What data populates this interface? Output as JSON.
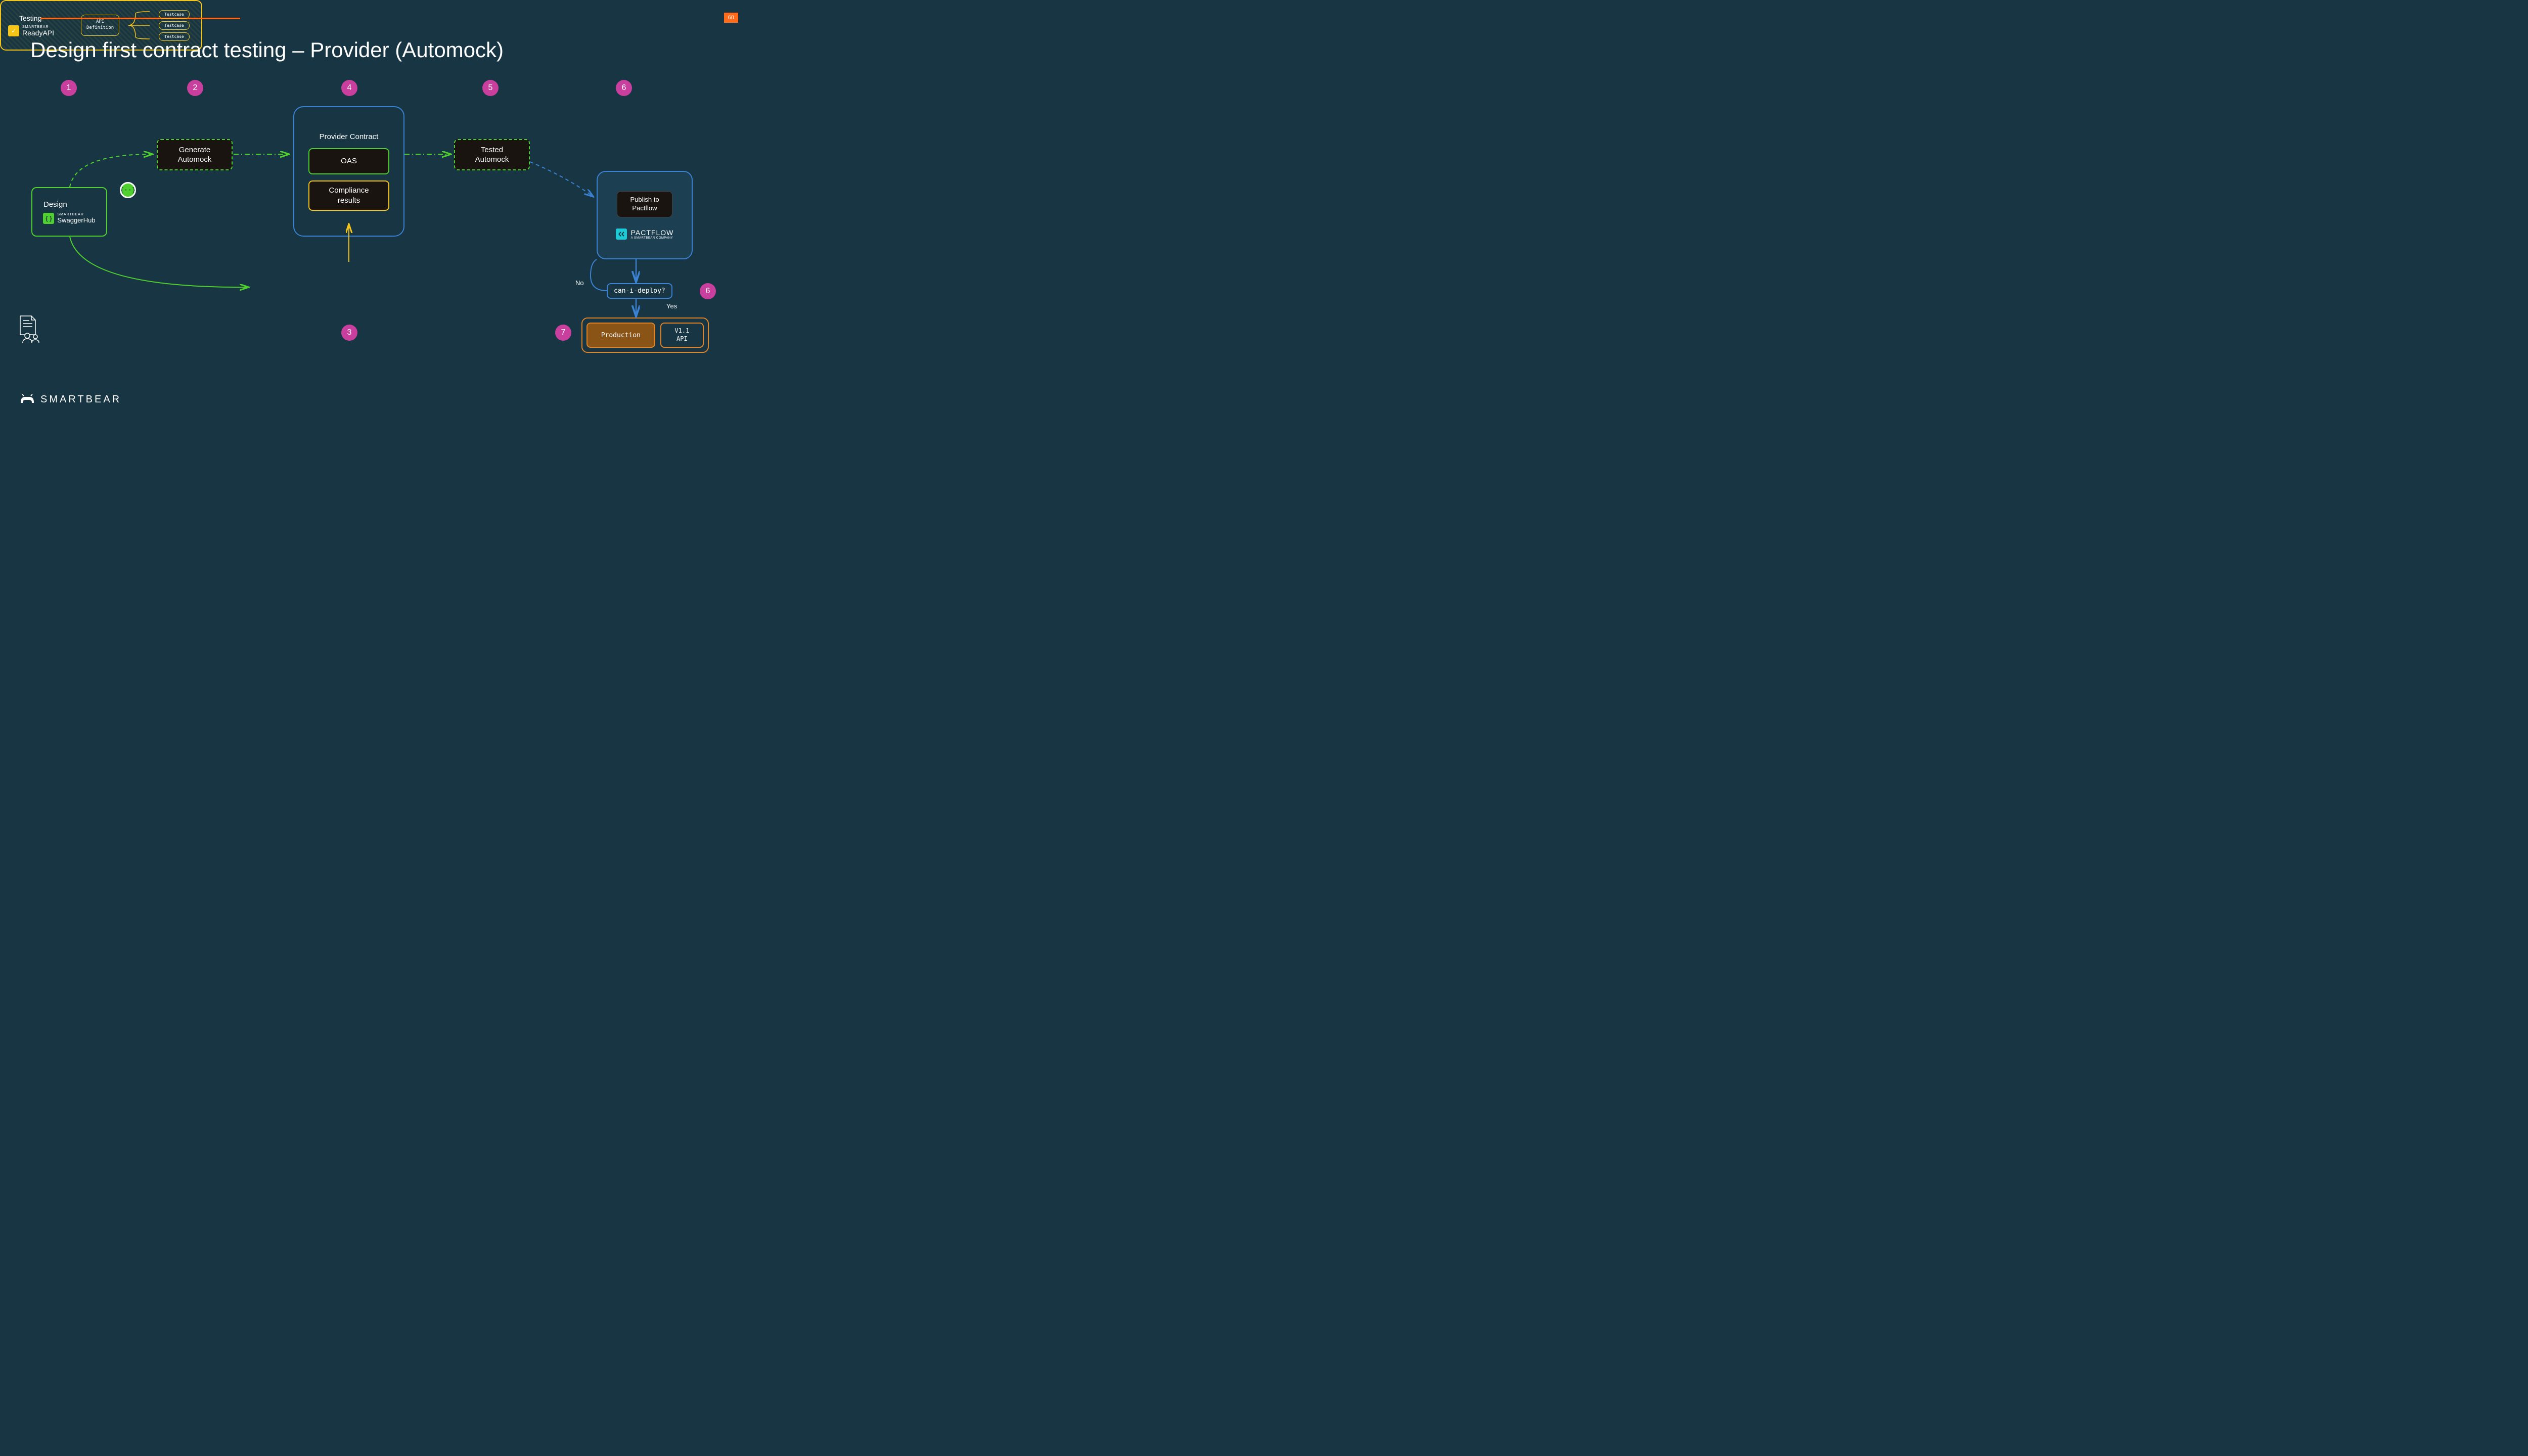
{
  "slide_number": "60",
  "title": "Design first contract testing – Provider (Automock)",
  "badges": {
    "b1": "1",
    "b2": "2",
    "b3": "3",
    "b4": "4",
    "b5": "5",
    "b6a": "6",
    "b6b": "6",
    "b7": "7"
  },
  "design": {
    "label": "Design",
    "logo_brand": "SMARTBEAR",
    "logo_name": "SwaggerHub"
  },
  "generate": {
    "label": "Generate\nAutomock"
  },
  "json_icon": "{··}",
  "provider": {
    "title": "Provider Contract",
    "oas": "OAS",
    "compliance": "Compliance\nresults"
  },
  "tested": {
    "label": "Tested\nAutomock"
  },
  "testing": {
    "label": "Testing",
    "logo_brand": "SMARTBEAR",
    "logo_name": "ReadyAPI",
    "api_def": "API\nDefinition",
    "testcase": "Testcase"
  },
  "pactflow": {
    "publish": "Publish to\nPactflow",
    "logo_name": "PACTFLOW",
    "logo_sub": "A SMARTBEAR COMPANY"
  },
  "cid": "can-i-deploy?",
  "no_label": "No",
  "yes_label": "Yes",
  "production": {
    "label": "Production",
    "version": "V1.1\nAPI"
  },
  "footer": "SMARTBEAR"
}
